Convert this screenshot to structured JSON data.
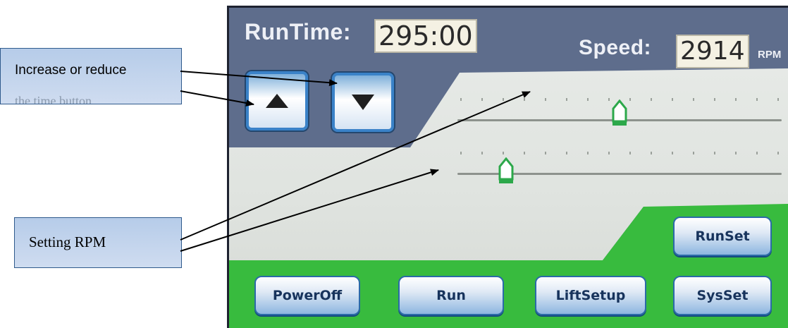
{
  "screen": {
    "runtime_label": "RunTime:",
    "runtime_value": "295:00",
    "speed_label": "Speed:",
    "speed_value": "2914",
    "speed_unit": "RPM",
    "buttons": {
      "up_icon": "triangle-up",
      "down_icon": "triangle-down",
      "runset": "RunSet",
      "poweroff": "PowerOff",
      "run": "Run",
      "liftsetup": "LiftSetup",
      "sysset": "SysSet"
    },
    "sliders": [
      {
        "position": 0.5
      },
      {
        "position": 0.15
      }
    ],
    "colors": {
      "frame": "#5e6d8c",
      "panel": "#e4e7e3",
      "green": "#38bb3e",
      "button_border": "#3a82c8"
    }
  },
  "annotations": {
    "callout_top_line1": "Increase or reduce",
    "callout_top_line2": "the time button",
    "callout_bottom": "Setting RPM"
  }
}
